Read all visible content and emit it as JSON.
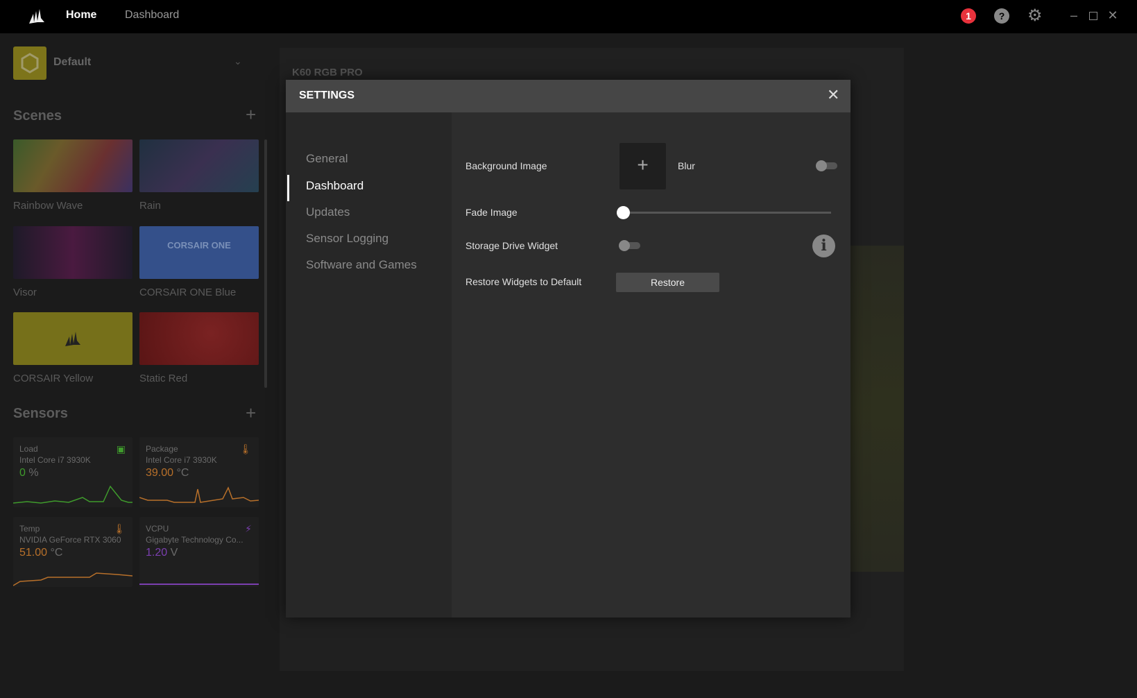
{
  "topbar": {
    "nav": [
      "Home",
      "Dashboard"
    ],
    "notification_count": "1",
    "help": "?",
    "icons": [
      "corsair-logo",
      "notification-icon",
      "help-icon",
      "gear-icon",
      "minimize-icon",
      "maximize-icon",
      "close-icon"
    ]
  },
  "profile": {
    "name": "Default"
  },
  "scenes": {
    "title": "Scenes",
    "items": [
      {
        "label": "Rainbow Wave"
      },
      {
        "label": "Rain"
      },
      {
        "label": "Visor"
      },
      {
        "label": "CORSAIR ONE Blue",
        "logo": "CORSAIR ONE"
      },
      {
        "label": "CORSAIR Yellow"
      },
      {
        "label": "Static Red"
      }
    ]
  },
  "sensors": {
    "title": "Sensors",
    "items": [
      {
        "name": "Load",
        "device": "Intel Core i7 3930K",
        "value": "0",
        "unit": "%",
        "color": "#3f9b2c",
        "icon": "cpu-icon"
      },
      {
        "name": "Package",
        "device": "Intel Core i7 3930K",
        "value": "39.00",
        "unit": "°C",
        "color": "#b8702a",
        "icon": "thermometer-icon"
      },
      {
        "name": "Temp",
        "device": "NVIDIA GeForce RTX 3060",
        "value": "51.00",
        "unit": "°C",
        "color": "#b8702a",
        "icon": "thermometer-icon"
      },
      {
        "name": "VCPU",
        "device": "Gigabyte Technology Co...",
        "value": "1.20",
        "unit": "V",
        "color": "#7b3fb0",
        "icon": "lightning-icon"
      }
    ]
  },
  "device": {
    "name": "K60 RGB PRO"
  },
  "settings": {
    "title": "SETTINGS",
    "nav": [
      "General",
      "Dashboard",
      "Updates",
      "Sensor Logging",
      "Software and Games"
    ],
    "active": "Dashboard",
    "background_image_label": "Background Image",
    "blur_label": "Blur",
    "blur_on": false,
    "fade_label": "Fade Image",
    "fade_value": 0,
    "storage_label": "Storage Drive Widget",
    "storage_on": false,
    "restore_label": "Restore Widgets to Default",
    "restore_button": "Restore"
  }
}
